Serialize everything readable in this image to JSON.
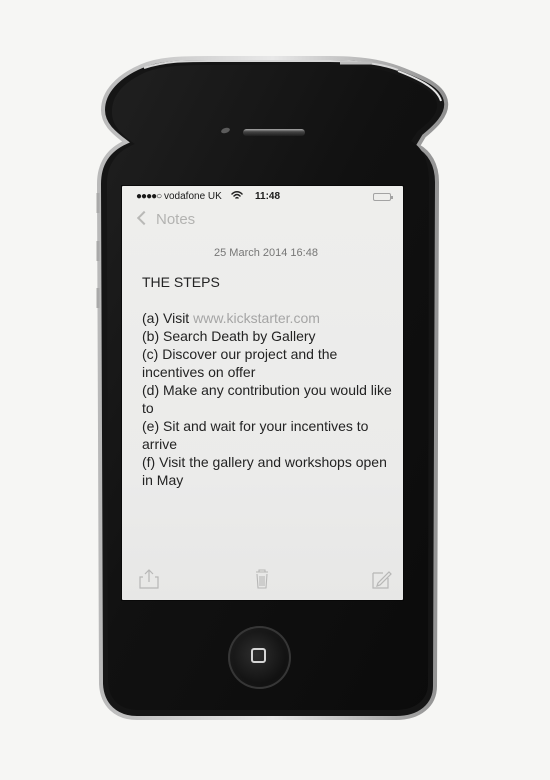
{
  "status_bar": {
    "signal": "●●●●○",
    "carrier": "vodafone UK",
    "wifi": "wifi-icon",
    "time": "11:48",
    "battery": "battery-icon"
  },
  "nav": {
    "back_label": "Notes",
    "back_icon": "chevron-left-icon"
  },
  "note": {
    "date": "25 March 2014 16:48",
    "title": "THE STEPS",
    "lines": [
      {
        "prefix": "(a) Visit ",
        "link": "www.kickstarter.com"
      },
      {
        "text": "(b) Search Death by Gallery"
      },
      {
        "text": "(c) Discover our project and the incentives on offer"
      },
      {
        "text": "(d) Make any contribution you would like to"
      },
      {
        "text": "(e) Sit and wait for your incentives to arrive"
      },
      {
        "text": "(f) Visit the gallery and workshops open in May"
      }
    ]
  },
  "toolbar": {
    "share": "share-icon",
    "delete": "trash-icon",
    "compose": "compose-icon"
  },
  "hardware": {
    "home": "home-button",
    "speaker": "speaker-grille",
    "camera": "front-camera"
  },
  "colors": {
    "paper": "#f6f6f4",
    "screen": "#ebebea",
    "phone_body": "#151515",
    "text": "#232323",
    "muted": "#a5a5a5"
  }
}
